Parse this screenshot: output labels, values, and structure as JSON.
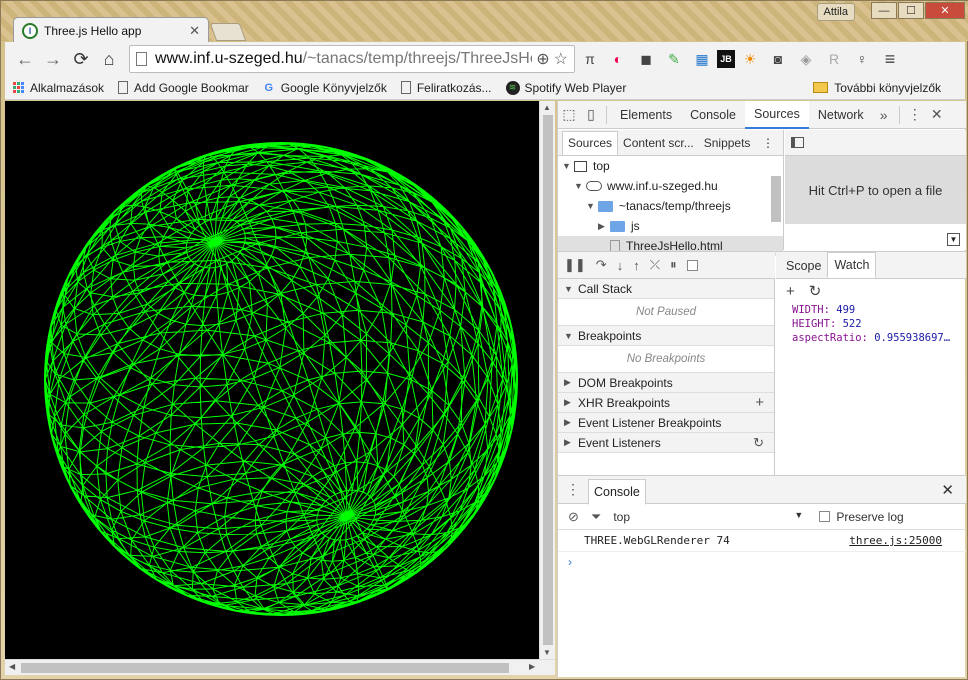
{
  "window": {
    "user": "Attila",
    "min": "—",
    "max": "☐",
    "close": "✕"
  },
  "tab": {
    "title": "Three.js Hello app",
    "close": "✕",
    "favicon": "I"
  },
  "toolbar": {
    "back": "←",
    "forward": "→",
    "reload": "⟳",
    "home": "⌂",
    "url_host": "www.inf.u-szeged.hu",
    "url_path": "/~tanacs/temp/threejs/ThreeJsHello.html",
    "zoom_icon": "⊕",
    "star_icon": "☆",
    "extensions": [
      "π",
      "◐",
      "◼",
      "✎",
      "▦",
      "JB",
      "☀",
      "◙",
      "◈",
      "R",
      "♀",
      "≡"
    ]
  },
  "bookmarks": {
    "items": [
      "Alkalmazások",
      "Add Google Bookmar",
      "Google Könyvjelzők",
      "Feliratkozás...",
      "Spotify Web Player"
    ],
    "other": "További könyvjelzők"
  },
  "devtools": {
    "tabs": [
      "Elements",
      "Console",
      "Sources",
      "Network"
    ],
    "active_tab": "Sources",
    "more": "»",
    "menu": "⋮",
    "close": "✕",
    "navigator": {
      "subtabs": [
        "Sources",
        "Content scr...",
        "Snippets"
      ],
      "tree": [
        {
          "label": "top"
        },
        {
          "label": "www.inf.u-szeged.hu"
        },
        {
          "label": "~tanacs/temp/threejs"
        },
        {
          "label": "js"
        },
        {
          "label": "ThreeJsHello.html"
        }
      ]
    },
    "editor": {
      "hint": "Hit Ctrl+P to open a file"
    },
    "panes": {
      "call_stack": "Call Stack",
      "call_stack_empty": "Not Paused",
      "breakpoints": "Breakpoints",
      "breakpoints_empty": "No Breakpoints",
      "dom_breakpoints": "DOM Breakpoints",
      "xhr_breakpoints": "XHR Breakpoints",
      "event_listener_breakpoints": "Event Listener Breakpoints",
      "event_listeners": "Event Listeners"
    },
    "scope_watch": {
      "tabs": [
        "Scope",
        "Watch"
      ],
      "active": "Watch",
      "watches": [
        {
          "name": "WIDTH",
          "value": "499"
        },
        {
          "name": "HEIGHT",
          "value": "522"
        },
        {
          "name": "aspectRatio",
          "value": "0.955938697…"
        }
      ]
    },
    "console": {
      "tab": "Console",
      "context": "top",
      "preserve_log": "Preserve log",
      "messages": [
        {
          "text": "THREE.WebGLRenderer 74",
          "source": "three.js:25000"
        }
      ],
      "prompt": "›"
    }
  },
  "colors": {
    "wireframe": "#00ff00",
    "canvas_bg": "#000000",
    "accent": "#3879d9"
  }
}
